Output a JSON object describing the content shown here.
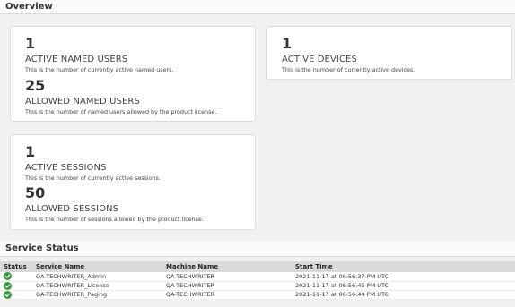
{
  "overview": {
    "title": "Overview",
    "cards": [
      {
        "stats": [
          {
            "value": "1",
            "label": "ACTIVE NAMED USERS",
            "description": "This is the number of currently active named users."
          },
          {
            "value": "25",
            "label": "ALLOWED NAMED USERS",
            "description": "This is the number of named users allowed by the product license."
          }
        ]
      },
      {
        "stats": [
          {
            "value": "1",
            "label": "ACTIVE DEVICES",
            "description": "This is the number of currently active devices."
          }
        ]
      },
      {
        "stats": [
          {
            "value": "1",
            "label": "ACTIVE SESSIONS",
            "description": "This is the number of currently active sessions."
          },
          {
            "value": "50",
            "label": "ALLOWED SESSIONS",
            "description": "This is the number of sessions allowed by the product license."
          }
        ]
      }
    ]
  },
  "service_status": {
    "title": "Service Status",
    "columns": [
      "Status",
      "Service Name",
      "Machine Name",
      "Start Time"
    ],
    "status_icon": "check-circle-icon",
    "status_color": "#2e9e3c",
    "rows": [
      {
        "service": "QA-TECHWRITER_Admin",
        "machine": "QA-TECHWRITER",
        "start": "2021-11-17 at 06:56:37 PM UTC"
      },
      {
        "service": "QA-TECHWRITER_License",
        "machine": "QA-TECHWRITER",
        "start": "2021-11-17 at 06:56:45 PM UTC"
      },
      {
        "service": "QA-TECHWRITER_Paging",
        "machine": "QA-TECHWRITER",
        "start": "2021-11-17 at 06:56:44 PM UTC"
      }
    ]
  }
}
